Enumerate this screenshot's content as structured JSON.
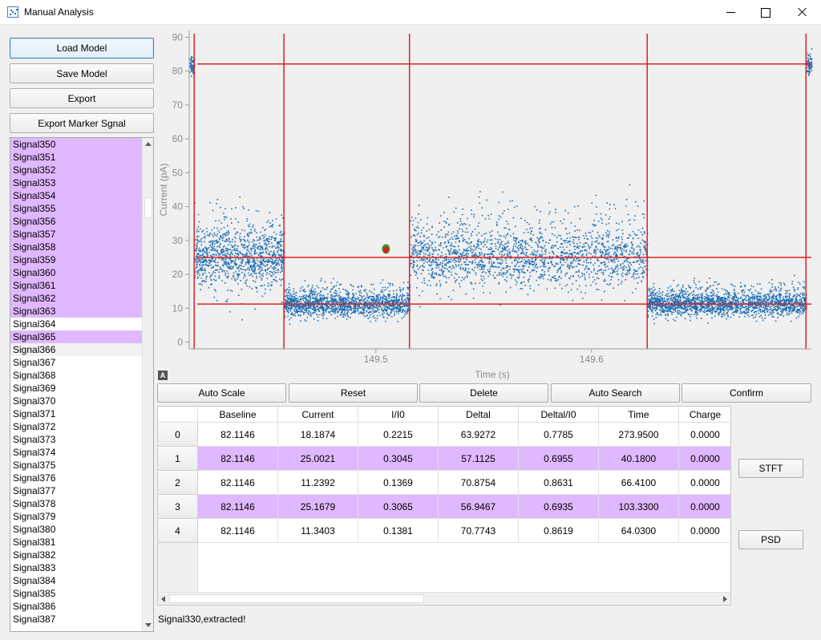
{
  "window": {
    "title": "Manual Analysis"
  },
  "sidebar": {
    "buttons": {
      "load_model": "Load Model",
      "save_model": "Save Model",
      "export": "Export",
      "export_marker": "Export Marker Sgnal"
    },
    "signals": [
      "Signal350",
      "Signal351",
      "Signal352",
      "Signal353",
      "Signal354",
      "Signal355",
      "Signal356",
      "Signal357",
      "Signal358",
      "Signal359",
      "Signal360",
      "Signal361",
      "Signal362",
      "Signal363",
      "Signal364",
      "Signal365",
      "Signal366",
      "Signal367",
      "Signal368",
      "Signal369",
      "Signal370",
      "Signal371",
      "Signal372",
      "Signal373",
      "Signal374",
      "Signal375",
      "Signal376",
      "Signal377",
      "Signal378",
      "Signal379",
      "Signal380",
      "Signal381",
      "Signal382",
      "Signal383",
      "Signal384",
      "Signal385",
      "Signal386",
      "Signal387"
    ],
    "selected_signals": [
      0,
      1,
      2,
      3,
      4,
      5,
      6,
      7,
      8,
      9,
      10,
      11,
      12,
      13,
      15
    ],
    "current_signal": 16
  },
  "chart_data": {
    "type": "scatter",
    "xlabel": "Time (s)",
    "ylabel": "Current (pA)",
    "xlim": [
      149.4135,
      149.7019
    ],
    "ylim": [
      -2,
      92
    ],
    "x_ticks": [
      149.5,
      149.6
    ],
    "y_ticks": [
      0,
      10,
      20,
      30,
      40,
      50,
      60,
      70,
      80,
      90
    ],
    "grid": false,
    "series_color": "#1f6fb5",
    "marker_color": "#e02020",
    "segments": [
      {
        "x_start": 149.4135,
        "x_end": 149.4158,
        "level": 82.1,
        "spread": 1.4
      },
      {
        "x_start": 149.4158,
        "x_end": 149.4574,
        "level": 24.5,
        "spread": 3.6
      },
      {
        "x_start": 149.4574,
        "x_end": 149.5156,
        "level": 11.2,
        "spread": 1.5
      },
      {
        "x_start": 149.5156,
        "x_end": 149.6258,
        "level": 25.0,
        "spread": 3.8
      },
      {
        "x_start": 149.6258,
        "x_end": 149.6994,
        "level": 11.3,
        "spread": 1.5
      },
      {
        "x_start": 149.6994,
        "x_end": 149.7019,
        "level": 82.1,
        "spread": 1.4
      }
    ],
    "vertical_markers": [
      149.4158,
      149.4574,
      149.5156,
      149.6258,
      149.6994
    ],
    "horizontal_markers": [
      82.1146,
      25.0021,
      11.2392
    ],
    "highlight_point": {
      "x": 149.5047,
      "y": 27.5,
      "color": "#2ca02c"
    }
  },
  "toolbar": {
    "auto_scale": "Auto Scale",
    "reset": "Reset",
    "delete": "Delete",
    "auto_search": "Auto Search",
    "confirm": "Confirm"
  },
  "table": {
    "columns": [
      "Baseline",
      "Current",
      "I/I0",
      "Deltal",
      "Deltal/I0",
      "Time",
      "Charge"
    ],
    "rows": [
      {
        "index": "0",
        "values": [
          "82.1146",
          "18.1874",
          "0.2215",
          "63.9272",
          "0.7785",
          "273.9500",
          "0.0000"
        ],
        "selected": false
      },
      {
        "index": "1",
        "values": [
          "82.1146",
          "25.0021",
          "0.3045",
          "57.1125",
          "0.6955",
          "40.1800",
          "0.0000"
        ],
        "selected": true
      },
      {
        "index": "2",
        "values": [
          "82.1146",
          "11.2392",
          "0.1369",
          "70.8754",
          "0.8631",
          "66.4100",
          "0.0000"
        ],
        "selected": false
      },
      {
        "index": "3",
        "values": [
          "82.1146",
          "25.1679",
          "0.3065",
          "56.9467",
          "0.6935",
          "103.3300",
          "0.0000"
        ],
        "selected": true
      },
      {
        "index": "4",
        "values": [
          "82.1146",
          "11.3403",
          "0.1381",
          "70.7743",
          "0.8619",
          "64.0300",
          "0.0000"
        ],
        "selected": false
      }
    ]
  },
  "side_buttons": {
    "stft": "STFT",
    "psd": "PSD"
  },
  "status": {
    "text": "Signal330,extracted!"
  }
}
